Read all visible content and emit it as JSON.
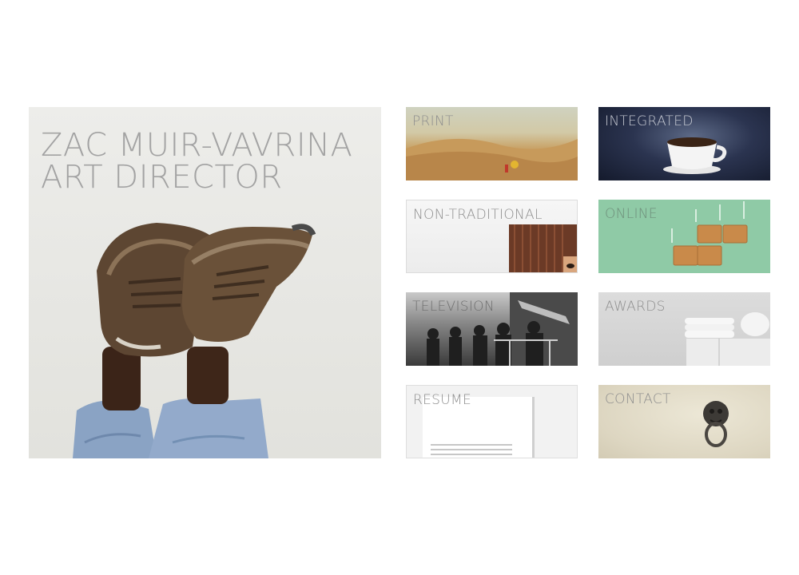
{
  "hero": {
    "name_line": "ZAC MUIR-VAVRINA",
    "role_line": "ART DIRECTOR",
    "image_icon": "sneakers-feet-up-photo"
  },
  "tiles": [
    {
      "label": "PRINT",
      "icon": "desert-dunes-photo"
    },
    {
      "label": "INTEGRATED",
      "icon": "coffee-cup-photo"
    },
    {
      "label": "NON-TRADITIONAL",
      "icon": "peeking-face-photo"
    },
    {
      "label": "ONLINE",
      "icon": "crackers-photo"
    },
    {
      "label": "TELEVISION",
      "icon": "vintage-film-crew-photo"
    },
    {
      "label": "AWARDS",
      "icon": "towels-shelf-photo"
    },
    {
      "label": "RESUME",
      "icon": "paper-document-photo"
    },
    {
      "label": "CONTACT",
      "icon": "door-knocker-photo"
    }
  ],
  "colors": {
    "background": "#ffffff",
    "text_gray": "#8e8e8e",
    "online_green": "#8fcaa6"
  }
}
